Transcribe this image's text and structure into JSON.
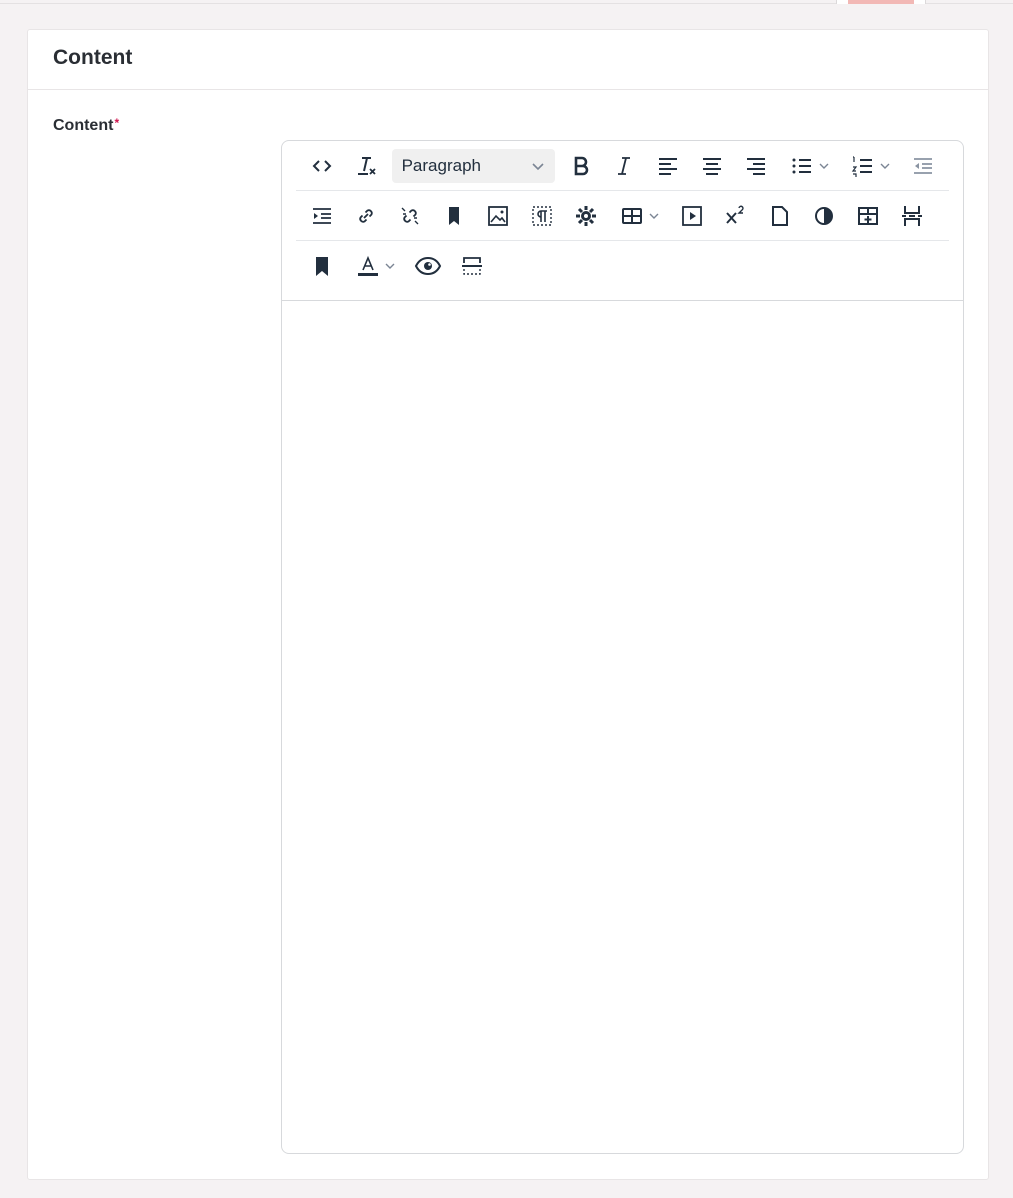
{
  "card": {
    "title": "Content"
  },
  "field": {
    "label": "Content",
    "required_mark": "*"
  },
  "editor": {
    "block_format": {
      "selected": "Paragraph"
    },
    "toolbar_rows": [
      [
        "source-code",
        "remove-format",
        "block-format",
        "bold",
        "italic",
        "align-left",
        "align-center",
        "align-right",
        "bullet-list",
        "numbered-list",
        "outdent"
      ],
      [
        "indent",
        "link",
        "unlink",
        "anchor",
        "image",
        "nonbreaking-space",
        "settings",
        "table",
        "media",
        "superscript",
        "template",
        "contrast",
        "insert-row",
        "page-break"
      ],
      [
        "bookmark",
        "text-color",
        "preview",
        "horizontal-rule"
      ]
    ],
    "content": ""
  },
  "colors": {
    "accent_required": "#d0154e",
    "icon": "#222f3e",
    "background": "#f5f2f3"
  }
}
